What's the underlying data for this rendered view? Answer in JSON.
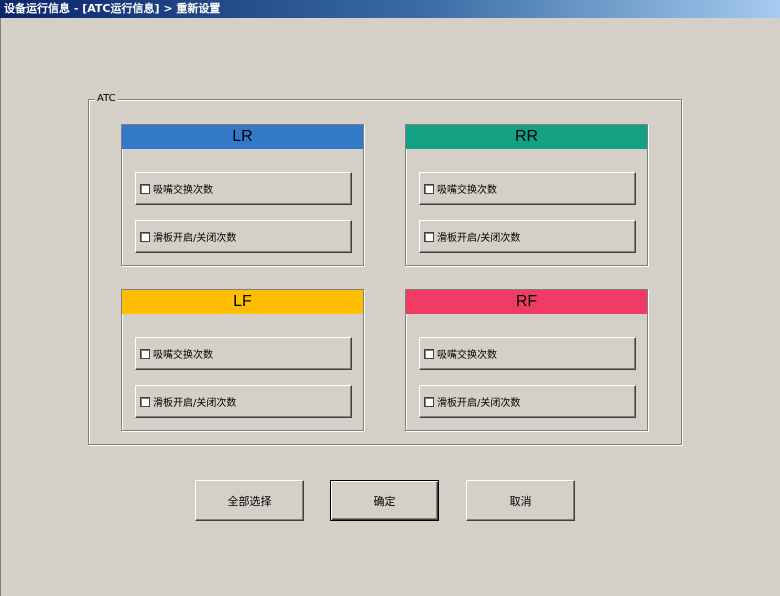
{
  "window": {
    "title": "设备运行信息 - [ATC运行信息] > 重新设置"
  },
  "group": {
    "label": "ATC"
  },
  "panels": [
    {
      "id": "lr",
      "title": "LR",
      "color": "#3478c8",
      "options": [
        {
          "label": "吸嘴交换次数",
          "checked": false
        },
        {
          "label": "滑板开启/关闭次数",
          "checked": false
        }
      ]
    },
    {
      "id": "rr",
      "title": "RR",
      "color": "#14a082",
      "options": [
        {
          "label": "吸嘴交换次数",
          "checked": false
        },
        {
          "label": "滑板开启/关闭次数",
          "checked": false
        }
      ]
    },
    {
      "id": "lf",
      "title": "LF",
      "color": "#ffbe00",
      "options": [
        {
          "label": "吸嘴交换次数",
          "checked": false
        },
        {
          "label": "滑板开启/关闭次数",
          "checked": false
        }
      ]
    },
    {
      "id": "rf",
      "title": "RF",
      "color": "#f03c64",
      "options": [
        {
          "label": "吸嘴交换次数",
          "checked": false
        },
        {
          "label": "滑板开启/关闭次数",
          "checked": false
        }
      ]
    }
  ],
  "buttons": {
    "select_all": "全部选择",
    "ok": "确定",
    "cancel": "取消"
  }
}
